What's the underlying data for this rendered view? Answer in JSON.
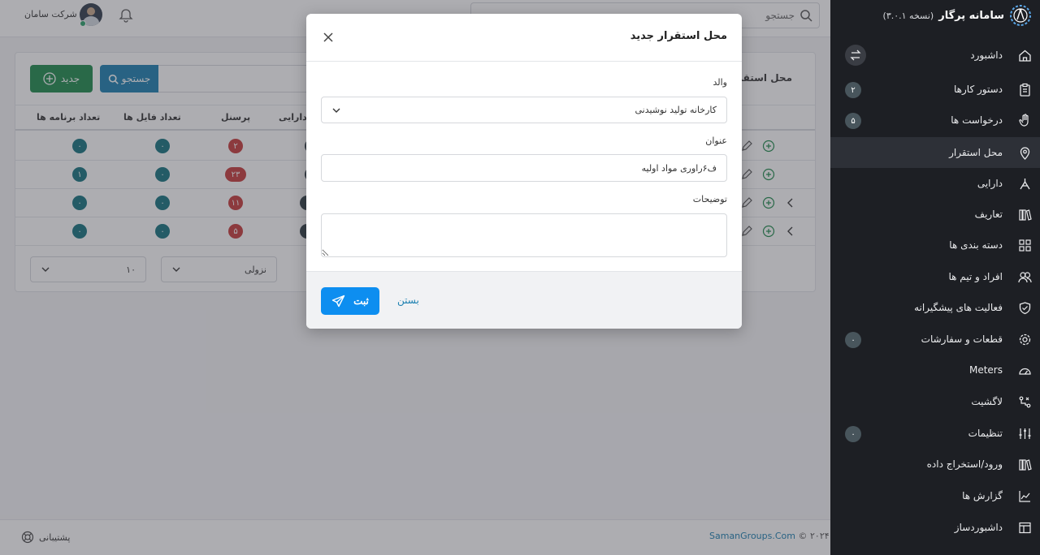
{
  "topbar": {
    "search_placeholder": "جستجو",
    "company": "شرکت سامان"
  },
  "card": {
    "title": "محل استقرار",
    "new_button": "جدید",
    "search_button": "جستجو",
    "columns": [
      "تعداد برنامه ها",
      "تعداد فایل ها",
      "پرسنل",
      "تعداد دارایی"
    ],
    "rows": [
      {
        "programs": "۰",
        "files": "۰",
        "staff": "۲",
        "has_expand": false
      },
      {
        "programs": "۱",
        "files": "۰",
        "staff": "۲۳",
        "has_expand": false
      },
      {
        "programs": "۰",
        "files": "۰",
        "staff": "۱۱",
        "has_expand": true
      },
      {
        "programs": "۰",
        "files": "۰",
        "staff": "۵",
        "has_expand": true
      }
    ],
    "pager_sort": "نزولی",
    "pager_size": "۱۰"
  },
  "footer": {
    "copyright_year": "© ۲۰۲۴",
    "copyright_link": "SamanGroups.Com",
    "support": "پشتیبانی"
  },
  "sidebar": {
    "brand_title": "سامانه پرگار",
    "brand_version": "(نسخه ۳.۰.۱)",
    "items": [
      {
        "label": "داشبورد",
        "icon": "home-icon",
        "badge": null,
        "toggle": true
      },
      {
        "label": "دستور کارها",
        "icon": "clipboard-icon",
        "badge": "۲"
      },
      {
        "label": "درخواست ها",
        "icon": "hand-icon",
        "badge": "۵"
      },
      {
        "label": "محل استقرار",
        "icon": "location-icon",
        "badge": null,
        "active": true
      },
      {
        "label": "دارایی",
        "icon": "asset-icon",
        "badge": null
      },
      {
        "label": "تعاریف",
        "icon": "books-icon",
        "badge": null
      },
      {
        "label": "دسته بندی ها",
        "icon": "grid-icon",
        "badge": null
      },
      {
        "label": "افراد و تیم ها",
        "icon": "people-icon",
        "badge": null
      },
      {
        "label": "فعالیت های پیشگیرانه",
        "icon": "shield-icon",
        "badge": null
      },
      {
        "label": "قطعات و سفارشات",
        "icon": "gear-icon",
        "badge": "۰"
      },
      {
        "label": "Meters",
        "icon": "gauge-icon",
        "badge": null
      },
      {
        "label": "لاگشیت",
        "icon": "log-icon",
        "badge": null
      },
      {
        "label": "تنظیمات",
        "icon": "sliders-icon",
        "badge": "۰"
      },
      {
        "label": "ورود/استخراج داده",
        "icon": "books-icon",
        "badge": null
      },
      {
        "label": "گزارش ها",
        "icon": "chart-icon",
        "badge": null
      },
      {
        "label": "داشبوردساز",
        "icon": "layout-icon",
        "badge": null
      }
    ]
  },
  "modal": {
    "title": "محل استقرار جدید",
    "parent_label": "والد",
    "parent_value": "کارخانه تولید نوشیدنی",
    "title_label": "عنوان",
    "title_value": "ف۶راوری مواد اولیه",
    "desc_label": "توضیحات",
    "desc_value": "",
    "submit": "ثبت",
    "close": "بستن"
  },
  "colors": {
    "sidebar_bg": "#1d1f24",
    "primary": "#0d8ef0",
    "success": "#1d8a4b",
    "teal_badge": "#13737e",
    "red_badge": "#c63a3a"
  }
}
